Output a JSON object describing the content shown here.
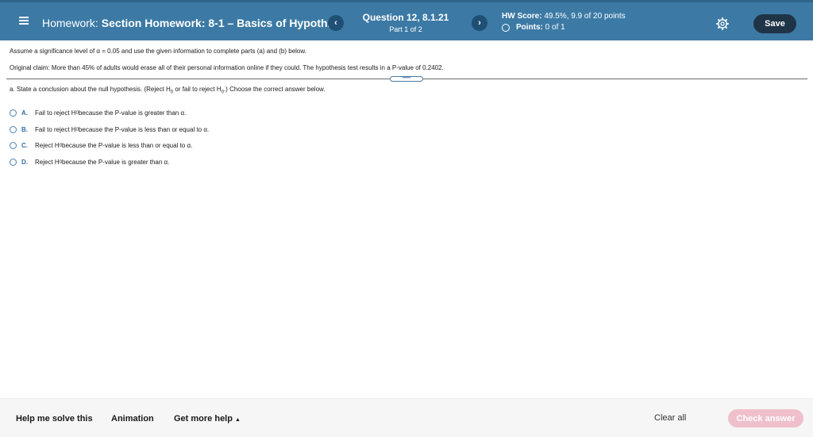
{
  "header": {
    "title_prefix": "Homework:",
    "title_name": "Section Homework: 8-1 – Basics of Hypoth...",
    "prev_label": "‹",
    "next_label": "›",
    "question_title": "Question 12, 8.1.21",
    "question_part": "Part 1 of 2",
    "score_label": "HW Score:",
    "score_value": "49.5%, 9.9 of 20 points",
    "points_label": "Points:",
    "points_value": "0 of 1",
    "save_label": "Save"
  },
  "content": {
    "instr1": "Assume a significance level of α = 0.05 and use the given information to complete parts (a) and (b) below.",
    "instr2": "Original claim: More than 45% of adults would erase all of their personal information online if they could. The hypothesis test results in a P-value of 0.2402.",
    "expander_label": "•••••",
    "part_a_1": "a. State a conclusion about the null hypothesis. (Reject H",
    "part_a_2": " or fail to reject H",
    "part_a_3": ".) Choose the correct answer below.",
    "sub_zero": "0",
    "options": [
      {
        "letter": "A.",
        "pre": "Fail to reject H",
        "post": " because the P-value is greater than α."
      },
      {
        "letter": "B.",
        "pre": "Fail to reject H",
        "post": " because the P-value is less than or equal to α."
      },
      {
        "letter": "C.",
        "pre": "Reject H",
        "post": " because the P-value is less than or equal to α."
      },
      {
        "letter": "D.",
        "pre": "Reject H",
        "post": " because the P-value is greater than α."
      }
    ]
  },
  "footer": {
    "help_label": "Help me solve this",
    "animation_label": "Animation",
    "more_help_label": "Get more help",
    "clear_label": "Clear all",
    "check_label": "Check answer"
  }
}
